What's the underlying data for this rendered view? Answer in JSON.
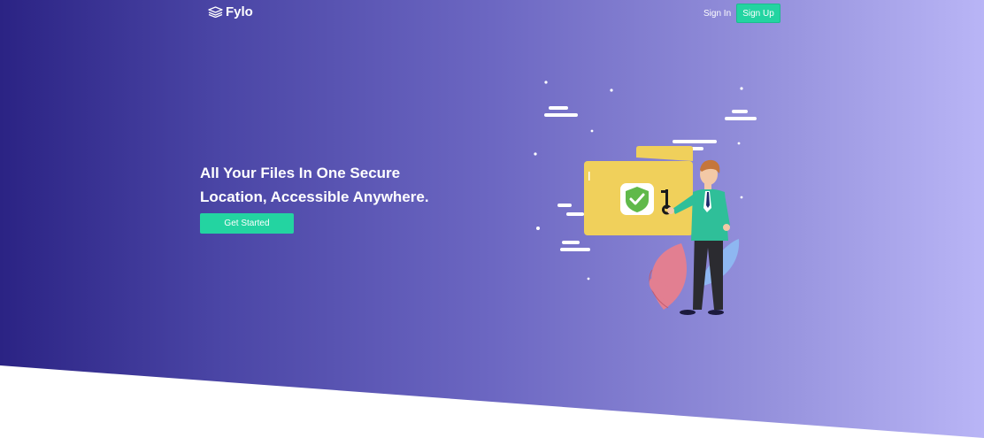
{
  "brand": {
    "name": "Fylo",
    "logo_icon": "layers-icon"
  },
  "nav": {
    "sign_in": "Sign In",
    "sign_up": "Sign Up"
  },
  "hero": {
    "headline_line1": "All Your Files In One Secure",
    "headline_line2": "Location, Accessible Anywhere.",
    "cta_label": "Get Started"
  },
  "colors": {
    "accent": "#23d4a1",
    "gradient_start": "#2b2384",
    "gradient_end": "#b9b5f6"
  }
}
